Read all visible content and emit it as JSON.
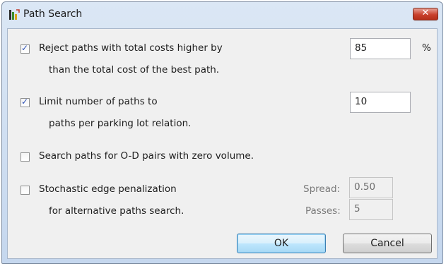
{
  "window": {
    "title": "Path Search"
  },
  "icons": {
    "app": "traffic-route-icon",
    "close": "close-icon"
  },
  "close_glyph": "✕",
  "options": {
    "reject": {
      "checked": true,
      "line1": "Reject paths with total costs higher by",
      "line2": "than the total cost of the best path.",
      "value": "85",
      "unit": "%"
    },
    "limit": {
      "checked": true,
      "line1": "Limit number of paths to",
      "line2": "paths per parking lot relation.",
      "value": "10"
    },
    "zero_volume": {
      "checked": false,
      "line1": "Search paths for O-D pairs with zero volume."
    },
    "stochastic": {
      "checked": false,
      "line1": "Stochastic edge penalization",
      "line2": "for alternative paths search.",
      "spread_label": "Spread:",
      "spread_value": "0.50",
      "passes_label": "Passes:",
      "passes_value": "5"
    }
  },
  "buttons": {
    "ok": "OK",
    "cancel": "Cancel"
  },
  "colors": {
    "accent": "#3c7fb1",
    "close": "#c9412c",
    "frame": "#c5d7ee"
  }
}
